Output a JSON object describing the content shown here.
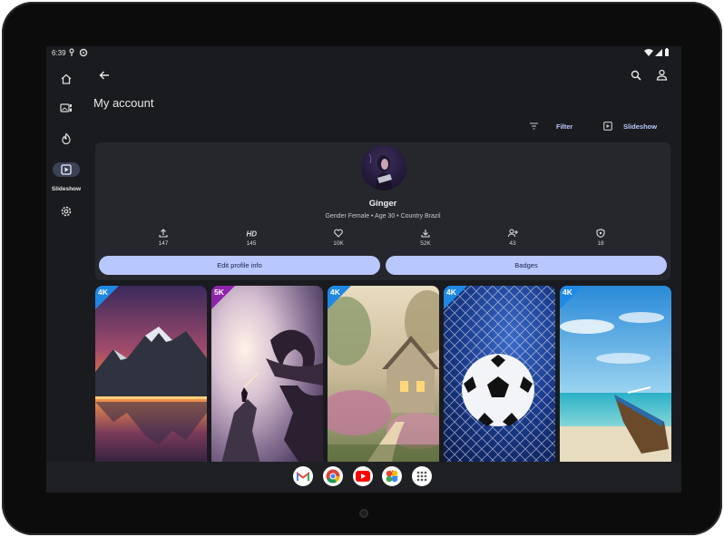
{
  "status_bar": {
    "time": "6:39"
  },
  "navigation_rail": {
    "items": [
      {
        "icon": "home-icon",
        "label": ""
      },
      {
        "icon": "wallpapers-icon",
        "label": ""
      },
      {
        "icon": "trending-icon",
        "label": ""
      },
      {
        "icon": "slideshow-icon",
        "label": "Slideshow",
        "active": true
      },
      {
        "icon": "settings-icon",
        "label": ""
      }
    ]
  },
  "header": {
    "title": "My account"
  },
  "toolbar": {
    "filter_label": "Filter",
    "slideshow_label": "Slideshow"
  },
  "profile": {
    "name": "Ginger",
    "meta": "Gender Female • Age 30 • Country Brazil",
    "stats": [
      {
        "icon": "upload-icon",
        "value": "147"
      },
      {
        "icon": "hd-icon",
        "value": "145"
      },
      {
        "icon": "heart-icon",
        "value": "10K"
      },
      {
        "icon": "download-icon",
        "value": "52K"
      },
      {
        "icon": "followers-icon",
        "value": "43"
      },
      {
        "icon": "badge-shield-icon",
        "value": "18"
      }
    ],
    "edit_button": "Edit profile info",
    "badges_button": "Badges"
  },
  "wallpapers": [
    {
      "badge": "4K",
      "subject": "mountain-lake-sunset"
    },
    {
      "badge": "5K",
      "subject": "dragon-warrior"
    },
    {
      "badge": "4K",
      "subject": "cottage-garden"
    },
    {
      "badge": "4K",
      "subject": "soccer-ball-net"
    },
    {
      "badge": "4K",
      "subject": "beach-boat"
    }
  ],
  "dock": {
    "apps": [
      "gmail-icon",
      "chrome-icon",
      "youtube-icon",
      "photos-icon",
      "app-drawer-icon"
    ]
  },
  "colors": {
    "accent": "#b9c7ff",
    "surface": "#25272c",
    "background": "#1a1b1f",
    "badge_4k": "#1e88e5",
    "badge_5k": "#8e24aa"
  }
}
